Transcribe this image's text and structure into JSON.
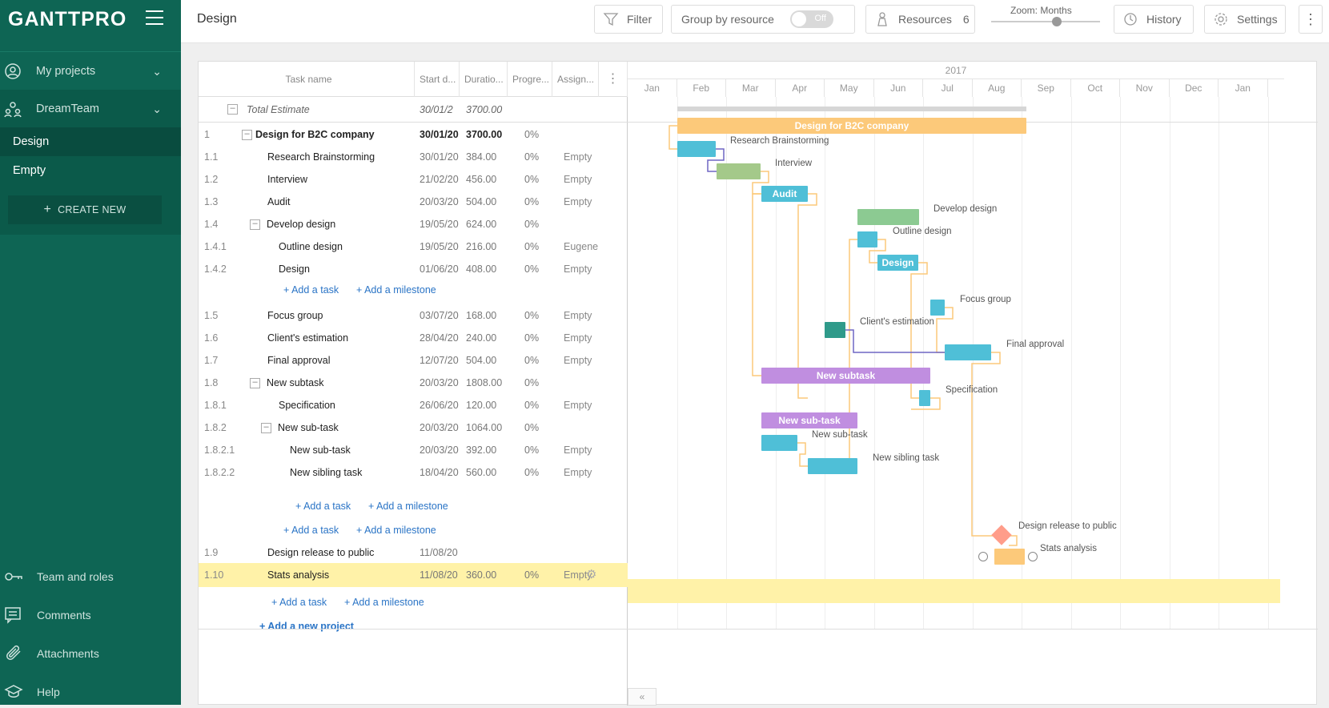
{
  "app": {
    "logo": "GANTTPRO",
    "page_title": "Design"
  },
  "sidebar": {
    "my_projects": "My projects",
    "team": "DreamTeam",
    "projects": [
      "Design",
      "Empty"
    ],
    "create_new": "CREATE NEW",
    "footer": [
      "Team and roles",
      "Comments",
      "Attachments",
      "Help"
    ]
  },
  "toolbar": {
    "filter": "Filter",
    "group_by": "Group by resource",
    "toggle": "Off",
    "resources": "Resources",
    "resources_count": "6",
    "zoom": "Zoom: Months",
    "zoom_level": 0.6,
    "history": "History",
    "settings": "Settings"
  },
  "grid": {
    "headers": [
      "Task name",
      "Start d...",
      "Duratio...",
      "Progre...",
      "Assign..."
    ],
    "total": {
      "name": "Total Estimate",
      "start": "30/01/2",
      "duration": "3700.00"
    },
    "rows": [
      {
        "num": "1",
        "name": "Design for B2C company",
        "start": "30/01/20",
        "duration": "3700.00",
        "progress": "0%",
        "assign": ""
      },
      {
        "num": "1.1",
        "name": "Research Brainstorming",
        "start": "30/01/20",
        "duration": "384.00",
        "progress": "0%",
        "assign": "Empty"
      },
      {
        "num": "1.2",
        "name": "Interview",
        "start": "21/02/20",
        "duration": "456.00",
        "progress": "0%",
        "assign": "Empty"
      },
      {
        "num": "1.3",
        "name": "Audit",
        "start": "20/03/20",
        "duration": "504.00",
        "progress": "0%",
        "assign": "Empty"
      },
      {
        "num": "1.4",
        "name": "Develop design",
        "start": "19/05/20",
        "duration": "624.00",
        "progress": "0%",
        "assign": ""
      },
      {
        "num": "1.4.1",
        "name": "Outline design",
        "start": "19/05/20",
        "duration": "216.00",
        "progress": "0%",
        "assign": "Eugene"
      },
      {
        "num": "1.4.2",
        "name": "Design",
        "start": "01/06/20",
        "duration": "408.00",
        "progress": "0%",
        "assign": "Empty"
      },
      {
        "num": "1.5",
        "name": "Focus group",
        "start": "03/07/20",
        "duration": "168.00",
        "progress": "0%",
        "assign": "Empty"
      },
      {
        "num": "1.6",
        "name": "Client's estimation",
        "start": "28/04/20",
        "duration": "240.00",
        "progress": "0%",
        "assign": "Empty"
      },
      {
        "num": "1.7",
        "name": "Final approval",
        "start": "12/07/20",
        "duration": "504.00",
        "progress": "0%",
        "assign": "Empty"
      },
      {
        "num": "1.8",
        "name": "New subtask",
        "start": "20/03/20",
        "duration": "1808.00",
        "progress": "0%",
        "assign": ""
      },
      {
        "num": "1.8.1",
        "name": "Specification",
        "start": "26/06/20",
        "duration": "120.00",
        "progress": "0%",
        "assign": "Empty"
      },
      {
        "num": "1.8.2",
        "name": "New sub-task",
        "start": "20/03/20",
        "duration": "1064.00",
        "progress": "0%",
        "assign": ""
      },
      {
        "num": "1.8.2.1",
        "name": "New sub-task",
        "start": "20/03/20",
        "duration": "392.00",
        "progress": "0%",
        "assign": "Empty"
      },
      {
        "num": "1.8.2.2",
        "name": "New sibling task",
        "start": "18/04/20",
        "duration": "560.00",
        "progress": "0%",
        "assign": "Empty"
      },
      {
        "num": "1.9",
        "name": "Design release to public",
        "start": "11/08/20",
        "duration": "",
        "progress": "",
        "assign": ""
      },
      {
        "num": "1.10",
        "name": "Stats analysis",
        "start": "11/08/20",
        "duration": "360.00",
        "progress": "0%",
        "assign": "Empty"
      }
    ],
    "add_task": "+ Add a task",
    "add_milestone": "+ Add a milestone",
    "add_project": "+ Add a new project"
  },
  "chart": {
    "year": "2017",
    "months": [
      "Jan",
      "Feb",
      "Mar",
      "Apr",
      "May",
      "Jun",
      "Jul",
      "Aug",
      "Sep",
      "Oct",
      "Nov",
      "Dec",
      "Jan"
    ],
    "bars": [
      {
        "label": "Design for B2C company",
        "color": "#fcc97a"
      },
      {
        "label": "Research Brainstorming",
        "color": "#4fbfd7"
      },
      {
        "label": "Interview",
        "color": "#a4c98a"
      },
      {
        "label": "Audit",
        "color": "#4fbfd7"
      },
      {
        "label": "Develop design",
        "color": "#8cca92"
      },
      {
        "label": "Outline design",
        "color": "#4fbfd7"
      },
      {
        "label": "Design",
        "color": "#4fbfd7"
      },
      {
        "label": "Focus group",
        "color": "#4fbfd7"
      },
      {
        "label": "Client's estimation",
        "color": "#2f9a8a"
      },
      {
        "label": "Final approval",
        "color": "#4fbfd7"
      },
      {
        "label": "New subtask",
        "color": "#c08ee0"
      },
      {
        "label": "Specification",
        "color": "#4fbfd7"
      },
      {
        "label": "New sub-task",
        "color": "#c08ee0"
      },
      {
        "label": "New sub-task",
        "color": "#4fbfd7"
      },
      {
        "label": "New sibling task",
        "color": "#4fbfd7"
      },
      {
        "label": "Design release to public",
        "color": "#ff9d8a"
      },
      {
        "label": "Stats analysis",
        "color": "#fcc97a"
      }
    ]
  }
}
